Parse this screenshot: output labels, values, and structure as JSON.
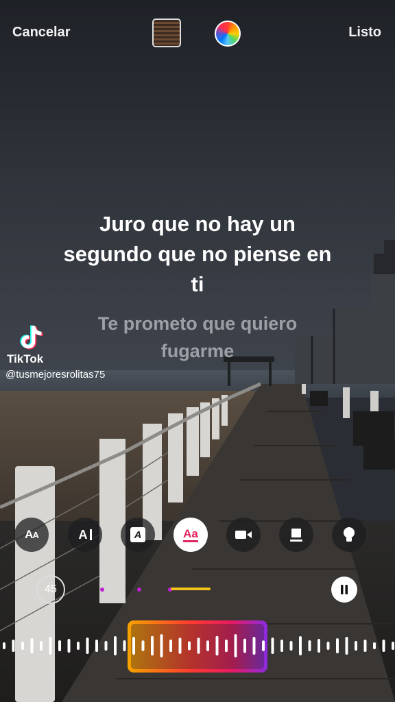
{
  "header": {
    "cancel_label": "Cancelar",
    "done_label": "Listo"
  },
  "lyrics": {
    "current": "Juro que no hay un segundo que no piense en ti",
    "next": "Te prometo que quiero fugarme"
  },
  "watermark": {
    "brand": "TikTok",
    "handle": "@tusmejoresrolitas75"
  },
  "style_options": [
    {
      "label": "AA",
      "icon": "text-size-icon"
    },
    {
      "label": "A",
      "icon": "text-align-icon"
    },
    {
      "label": "A",
      "icon": "text-box-icon"
    },
    {
      "label": "Aa",
      "icon": "lyrics-style-icon",
      "active": true
    },
    {
      "label": "",
      "icon": "video-icon"
    },
    {
      "label": "",
      "icon": "card-icon"
    },
    {
      "label": "",
      "icon": "lightbulb-icon"
    }
  ],
  "playback": {
    "duration": "45",
    "state": "playing"
  },
  "colors": {
    "accent_yellow": "#f5c21b",
    "accent_magenta": "#c21ed6",
    "selector_gradient": [
      "#f5a300",
      "#ff3b30",
      "#e51a63",
      "#8a2be2"
    ]
  }
}
